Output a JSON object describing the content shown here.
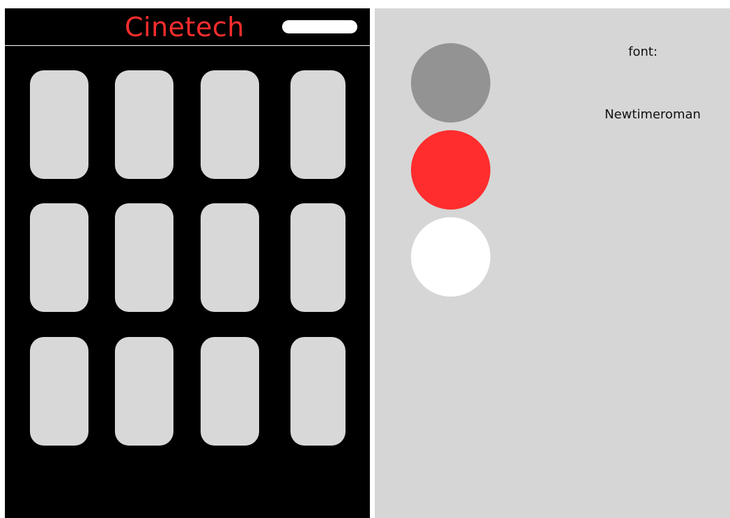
{
  "app": {
    "title": "Cinetech"
  },
  "movie_grid": {
    "rows": 3,
    "columns": 4
  },
  "style_guide": {
    "colors": [
      "#939393",
      "#ff2d2d",
      "#ffffff"
    ],
    "font_label": "font:",
    "font_name": "Newtimeroman"
  }
}
